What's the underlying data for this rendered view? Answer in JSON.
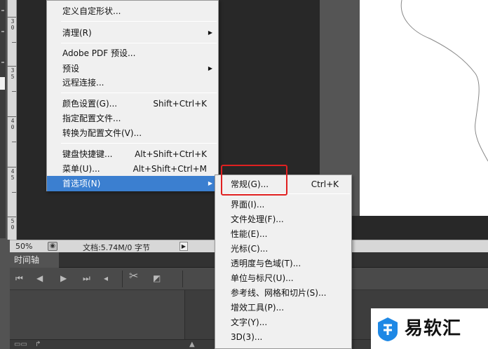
{
  "main_menu": {
    "items": [
      {
        "label": "定义自定形状...",
        "shortcut": "",
        "submenu": false
      },
      {
        "label": "清理(R)",
        "shortcut": "",
        "submenu": true
      },
      {
        "label": "Adobe PDF 预设...",
        "shortcut": "",
        "submenu": false
      },
      {
        "label": "预设",
        "shortcut": "",
        "submenu": true
      },
      {
        "label": "远程连接...",
        "shortcut": "",
        "submenu": false
      },
      {
        "label": "颜色设置(G)...",
        "shortcut": "Shift+Ctrl+K",
        "submenu": false
      },
      {
        "label": "指定配置文件...",
        "shortcut": "",
        "submenu": false
      },
      {
        "label": "转换为配置文件(V)...",
        "shortcut": "",
        "submenu": false
      },
      {
        "label": "键盘快捷键...",
        "shortcut": "Alt+Shift+Ctrl+K",
        "submenu": false
      },
      {
        "label": "菜单(U)...",
        "shortcut": "Alt+Shift+Ctrl+M",
        "submenu": false
      },
      {
        "label": "首选项(N)",
        "shortcut": "",
        "submenu": true,
        "active": true
      }
    ],
    "arrow_glyph": "▶"
  },
  "preferences_submenu": {
    "items": [
      {
        "label": "常规(G)...",
        "shortcut": "Ctrl+K"
      },
      {
        "label": "界面(I)..."
      },
      {
        "label": "文件处理(F)..."
      },
      {
        "label": "性能(E)..."
      },
      {
        "label": "光标(C)..."
      },
      {
        "label": "透明度与色域(T)..."
      },
      {
        "label": "单位与标尺(U)..."
      },
      {
        "label": "参考线、网格和切片(S)..."
      },
      {
        "label": "增效工具(P)..."
      },
      {
        "label": "文字(Y)..."
      },
      {
        "label": "3D(3)..."
      }
    ]
  },
  "status_bar": {
    "zoom": "50%",
    "doc_info": "文档:5.74M/0 字节"
  },
  "timeline": {
    "tab_label": "时间轴"
  },
  "ruler": {
    "labels": [
      "3\n0",
      "3\n5",
      "4\n0",
      "4\n5",
      "5\n0"
    ]
  },
  "watermark": {
    "text": "易软汇",
    "logo_color": "#1e88e5"
  },
  "colors": {
    "menu_highlight": "#3b7fd0",
    "callout_border": "#e02020"
  }
}
